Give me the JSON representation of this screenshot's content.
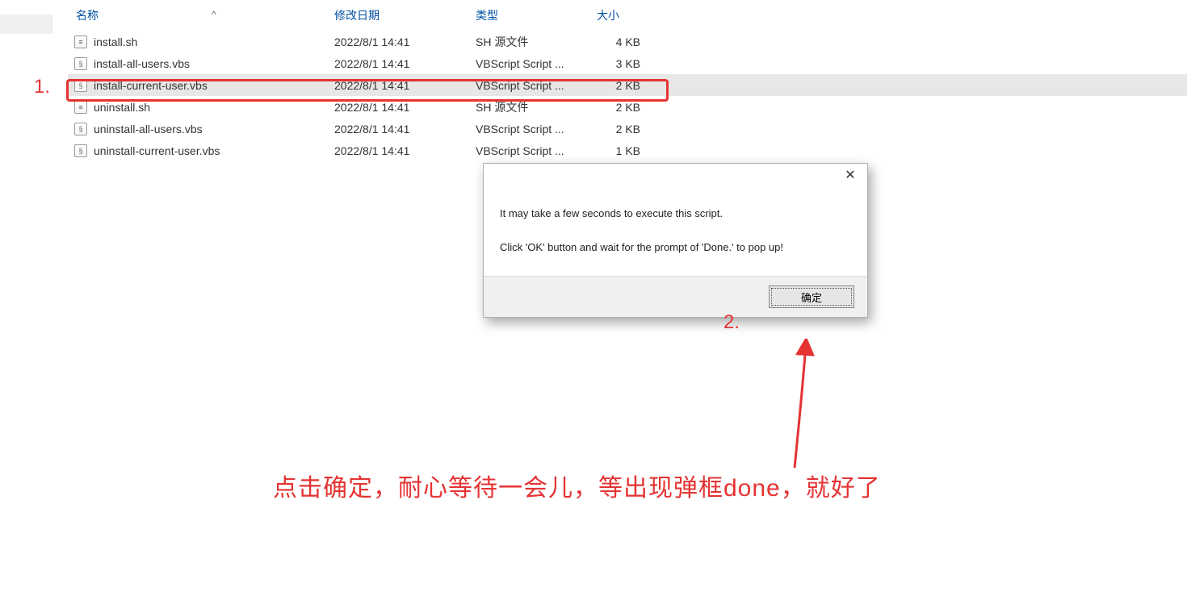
{
  "columnHeaders": {
    "name": "名称",
    "date": "修改日期",
    "type": "类型",
    "size": "大小",
    "sortIndicator": "^"
  },
  "files": [
    {
      "name": "install.sh",
      "date": "2022/8/1 14:41",
      "type": "SH 源文件",
      "size": "4 KB",
      "iconKind": "sh",
      "highlighted": false
    },
    {
      "name": "install-all-users.vbs",
      "date": "2022/8/1 14:41",
      "type": "VBScript Script ...",
      "size": "3 KB",
      "iconKind": "vbs",
      "highlighted": false
    },
    {
      "name": "install-current-user.vbs",
      "date": "2022/8/1 14:41",
      "type": "VBScript Script ...",
      "size": "2 KB",
      "iconKind": "vbs",
      "highlighted": true
    },
    {
      "name": "uninstall.sh",
      "date": "2022/8/1 14:41",
      "type": "SH 源文件",
      "size": "2 KB",
      "iconKind": "sh",
      "highlighted": false
    },
    {
      "name": "uninstall-all-users.vbs",
      "date": "2022/8/1 14:41",
      "type": "VBScript Script ...",
      "size": "2 KB",
      "iconKind": "vbs",
      "highlighted": false
    },
    {
      "name": "uninstall-current-user.vbs",
      "date": "2022/8/1 14:41",
      "type": "VBScript Script ...",
      "size": "1 KB",
      "iconKind": "vbs",
      "highlighted": false
    }
  ],
  "dialog": {
    "line1": "It may take a few seconds to execute this script.",
    "line2": "Click 'OK' button and wait for the prompt of 'Done.' to pop up!",
    "okLabel": "确定",
    "closeGlyph": "✕"
  },
  "annotations": {
    "step1": "1.",
    "step2": "2.",
    "bottomNote": "点击确定，耐心等待一会儿，等出现弹框done，就好了",
    "accentColor": "#e53333"
  }
}
